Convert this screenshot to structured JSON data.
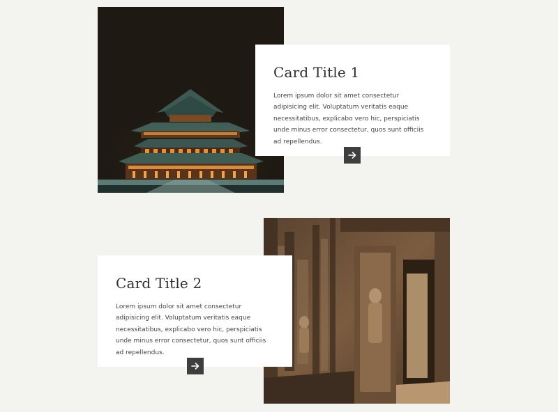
{
  "cards": [
    {
      "title": "Card Title 1",
      "text": "Lorem ipsum dolor sit amet consectetur adipisicing elit. Voluptatum veritatis eaque necessitatibus, explicabo vero hic, perspiciatis unde minus error consectetur, quos sunt officiis ad repellendus.",
      "image": "pagoda-night-photo",
      "button_icon": "arrow-right-icon"
    },
    {
      "title": "Card Title 2",
      "text": "Lorem ipsum dolor sit amet consectetur adipisicing elit. Voluptatum veritatis eaque necessitatibus, explicabo vero hic, perspiciatis unde minus error consectetur, quos sunt officiis ad repellendus.",
      "image": "temple-ruins-photo",
      "button_icon": "arrow-right-icon"
    }
  ],
  "colors": {
    "page_background": "#f3f3ef",
    "card_background": "#ffffff",
    "button_background": "#3e3e3e",
    "title_color": "#2f2f2f",
    "text_color": "#454545"
  }
}
